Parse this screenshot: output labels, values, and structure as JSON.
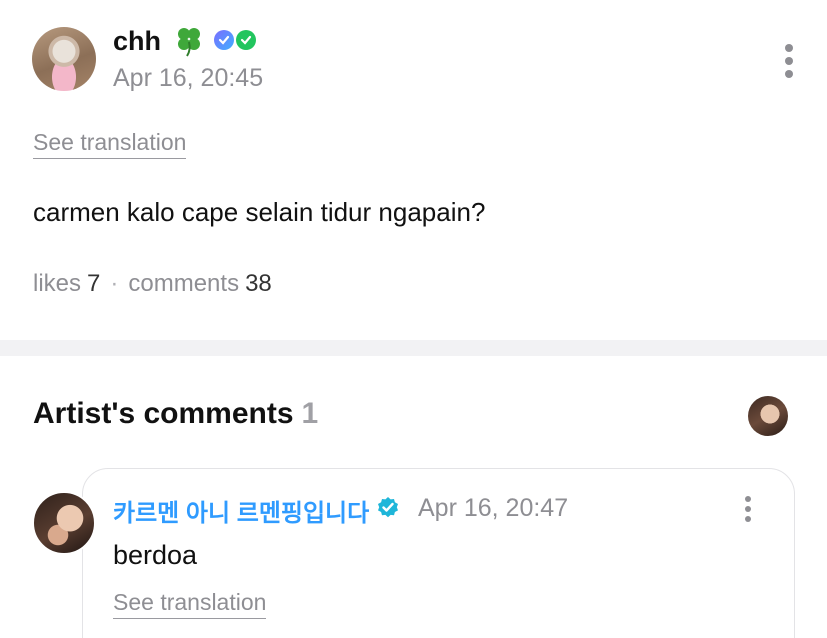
{
  "post": {
    "username": "chh",
    "timestamp": "Apr 16, 20:45",
    "see_translation": "See translation",
    "body": "carmen kalo cape selain tidur ngapain?",
    "likes_label": "likes",
    "likes_count": "7",
    "separator": "·",
    "comments_label": "comments",
    "comments_count": "38",
    "icons": [
      "avatar",
      "four-leaf-clover-icon",
      "membership-badge-icon",
      "verified-green-badge-icon",
      "more-options-icon"
    ]
  },
  "artist_section": {
    "title": "Artist's comments",
    "count": "1"
  },
  "artist_comment": {
    "name": "카르멘 아니 르멘핑입니다",
    "timestamp": "Apr 16, 20:47",
    "body": "berdoa",
    "see_translation": "See translation",
    "icons": [
      "verified-icon",
      "more-options-icon"
    ]
  },
  "colors": {
    "artist_name": "#2f9bff",
    "muted_text": "#8e8e93",
    "divider": "#f2f2f4",
    "verified": "#1fb6d9"
  }
}
